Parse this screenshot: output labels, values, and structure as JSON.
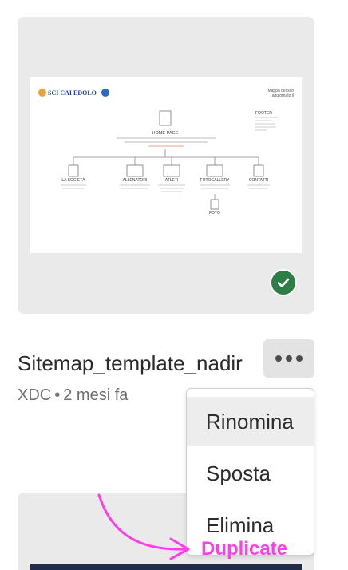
{
  "file": {
    "name": "Sitemap_template_nadir",
    "type": "XDC",
    "separator": "•",
    "modified": "2 mesi fa",
    "synced_icon": "checkmark-icon"
  },
  "thumbnail": {
    "logo_text": "SCI CAI EDOLO",
    "corner_title_1": "Mappa del sito",
    "corner_title_2": "aggiornato il",
    "home_label": "HOME PAGE",
    "footer_label": "FOOTER",
    "pages": [
      "LA SOCIETÀ",
      "ALLENATORI",
      "ATLETI",
      "FOTOGALLERY",
      "CONTATTI"
    ],
    "sub_page": "FOTO"
  },
  "more_button_icon": "more-options-icon",
  "menu": {
    "items": [
      "Rinomina",
      "Sposta",
      "Elimina"
    ]
  },
  "annotation": {
    "label": "Duplicate",
    "color": "#ff3ee8"
  }
}
